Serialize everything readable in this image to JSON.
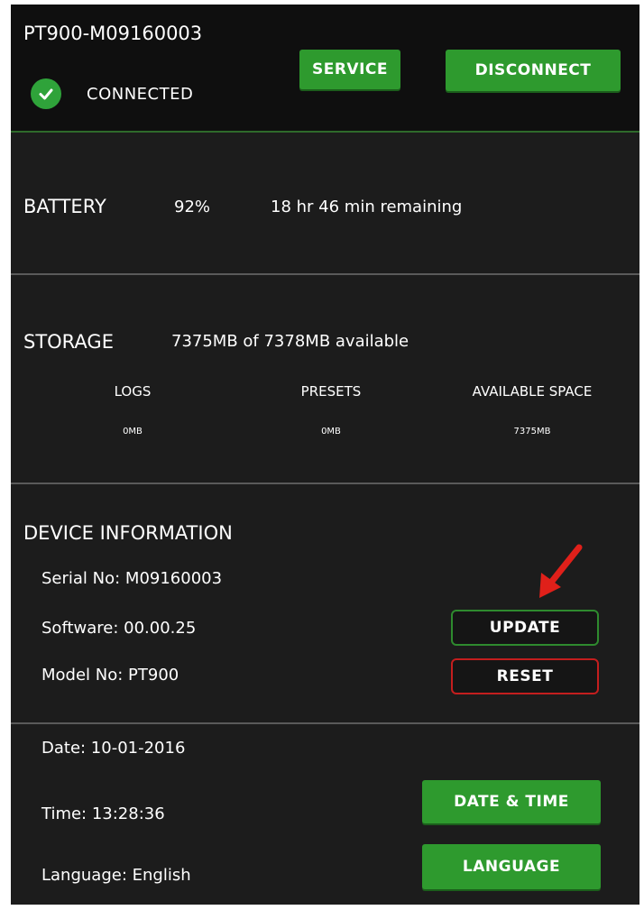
{
  "header": {
    "device_name": "PT900-M09160003",
    "status_label": "CONNECTED",
    "service_label": "SERVICE",
    "disconnect_label": "DISCONNECT"
  },
  "battery": {
    "label": "BATTERY",
    "percent": "92%",
    "remaining": "18 hr 46 min remaining"
  },
  "storage": {
    "label": "STORAGE",
    "summary": "7375MB of 7378MB available",
    "columns": [
      {
        "label": "LOGS",
        "value": "0MB"
      },
      {
        "label": "PRESETS",
        "value": "0MB"
      },
      {
        "label": "AVAILABLE SPACE",
        "value": "7375MB"
      }
    ]
  },
  "device_info": {
    "title": "DEVICE INFORMATION",
    "serial": "Serial No: M09160003",
    "software": "Software: 00.00.25",
    "model": "Model No: PT900",
    "update_label": "UPDATE",
    "reset_label": "RESET"
  },
  "settings": {
    "date": "Date: 10-01-2016",
    "time": "Time: 13:28:36",
    "language": "Language: English",
    "date_time_label": "DATE & TIME",
    "language_button_label": "LANGUAGE"
  },
  "colors": {
    "accent_green": "#2e9a2e",
    "update_border": "#2e8a2e",
    "reset_border": "#c41e1e",
    "arrow": "#e0201a"
  }
}
